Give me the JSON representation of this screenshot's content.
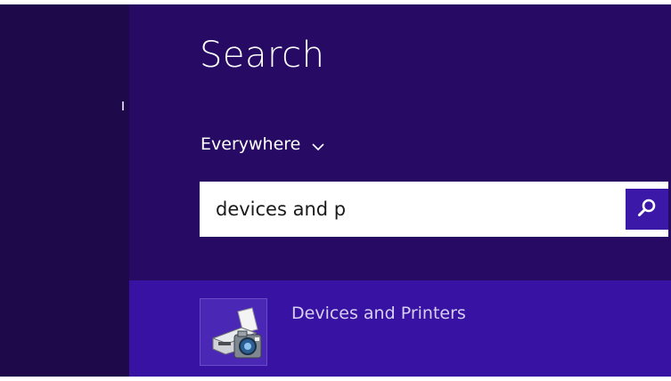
{
  "search_pane": {
    "title": "Search",
    "scope": {
      "label": "Everywhere",
      "icon": "chevron-down-icon"
    },
    "search_box": {
      "value": "devices and p",
      "button_icon": "search-icon"
    },
    "results": [
      {
        "label": "Devices and Printers",
        "icon": "devices-and-printers-icon"
      }
    ]
  },
  "colors": {
    "left_strip": "#1e0a4b",
    "pane_background": "#260a63",
    "result_highlight": "#3712a3",
    "search_button": "#3b18a7",
    "text": "#ffffff"
  }
}
